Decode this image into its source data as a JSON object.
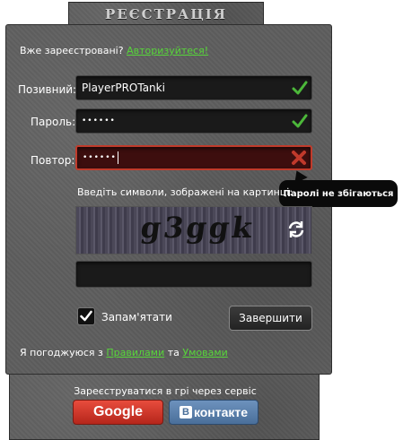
{
  "header": {
    "title": "РЕЄСТРАЦІЯ"
  },
  "login_prompt": {
    "text": "Вже зареєстровані?",
    "link": "Авторизуйтеся!"
  },
  "form": {
    "callsign_label": "Позивний:",
    "callsign_value": "PlayerPROTanki",
    "password_label": "Пароль:",
    "password_value": "••••••",
    "repeat_label": "Повтор:",
    "repeat_value": "••••••",
    "error_tooltip": "Паролі не збігаються",
    "captcha_label": "Введіть символи, зображені на картинці:",
    "captcha_image_text": "g3ggk",
    "remember_label": "Запам'ятати",
    "finish_button": "Завершити"
  },
  "terms": {
    "prefix": "Я погоджуюся з",
    "rules_link": "Правилами",
    "and": "та",
    "terms_link": "Умовами"
  },
  "social": {
    "prompt": "Зареєструватися в грі через сервіс",
    "google": "Google",
    "vk_logo": "B",
    "vk": "контакте"
  },
  "colors": {
    "link": "#57d63a",
    "error_border": "#c03b2b",
    "check": "#4cb83a"
  }
}
